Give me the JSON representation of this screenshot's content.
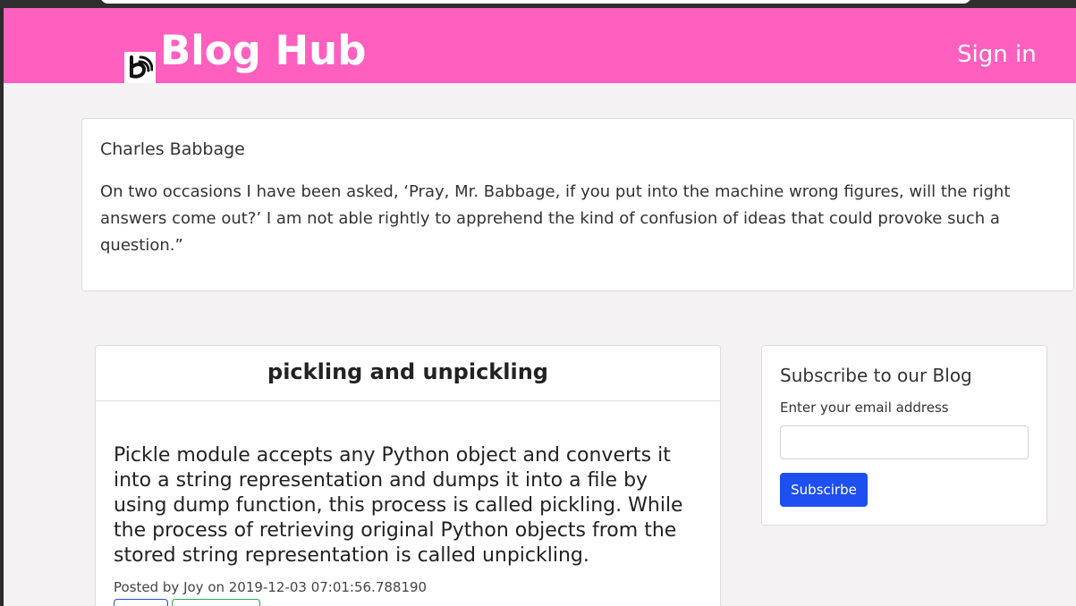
{
  "header": {
    "brand": "Blog Hub",
    "brand_icon": "blogger-icon",
    "signin": "Sign in",
    "background": "#ff5fbf"
  },
  "quote": {
    "author": "Charles Babbage",
    "text": "On two occasions I have been asked, ‘Pray, Mr. Babbage, if you put into the machine wrong figures, will the right answers come out?’ I am not able rightly to apprehend the kind of confusion of ideas that could provoke such a question.”"
  },
  "post": {
    "title": "pickling and unpickling",
    "body": "Pickle module accepts any Python object and converts it into a string representation and dumps it into a file by using dump function, this process is called pickling. While the process of retrieving original Python objects from the stored string representation is called unpickling.",
    "meta": "Posted by Joy on 2019-12-03 07:01:56.788190"
  },
  "subscribe": {
    "title": "Subscribe to our Blog",
    "label": "Enter your email address",
    "email_value": "",
    "button": "Subscirbe",
    "button_color": "#1e4ff0"
  }
}
